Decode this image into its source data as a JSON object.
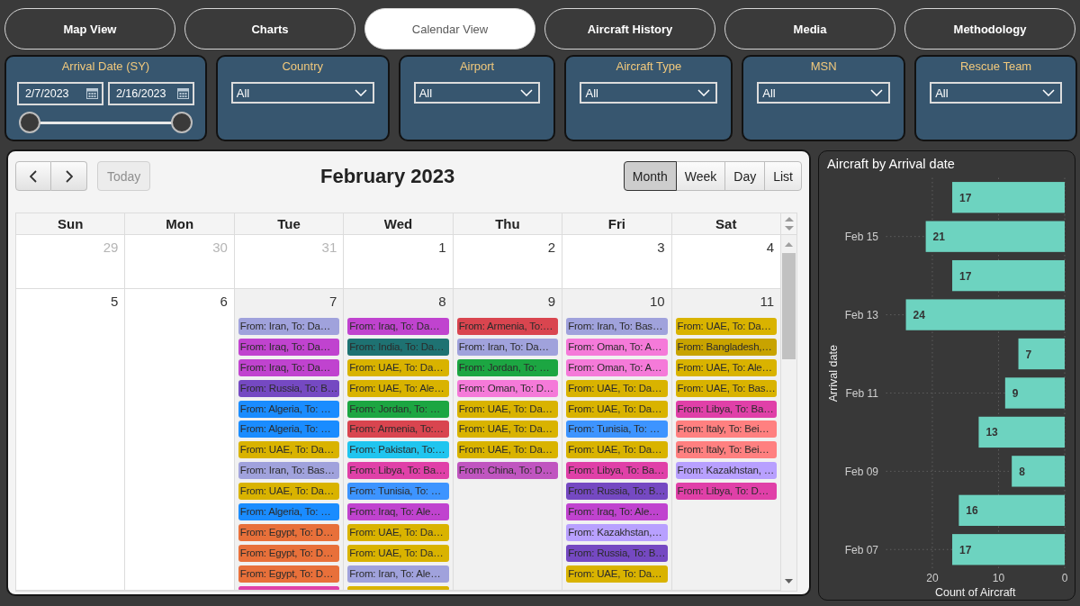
{
  "nav_tabs": [
    {
      "label": "Map View",
      "selected": false
    },
    {
      "label": "Charts",
      "selected": false
    },
    {
      "label": "Calendar View",
      "selected": true
    },
    {
      "label": "Aircraft History",
      "selected": false
    },
    {
      "label": "Media",
      "selected": false
    },
    {
      "label": "Methodology",
      "selected": false
    }
  ],
  "filters": [
    {
      "kind": "date_range",
      "title": "Arrival Date (SY)",
      "start_date": "2/7/2023",
      "end_date": "2/16/2023",
      "thumbs": [
        {
          "level": 0
        },
        {
          "level": 1
        }
      ]
    },
    {
      "kind": "dropdown",
      "title": "Country",
      "value": "All"
    },
    {
      "kind": "dropdown",
      "title": "Airport",
      "value": "All"
    },
    {
      "kind": "dropdown",
      "title": "Aircraft Type",
      "value": "All"
    },
    {
      "kind": "dropdown",
      "title": "MSN",
      "value": "All"
    },
    {
      "kind": "dropdown",
      "title": "Rescue Team",
      "value": "All"
    }
  ],
  "calendar": {
    "today_button": {
      "label": "Today",
      "disabled": true
    },
    "title": "February 2023",
    "views": [
      {
        "label": "Month",
        "selected": true
      },
      {
        "label": "Week",
        "selected": false
      },
      {
        "label": "Day",
        "selected": false
      },
      {
        "label": "List",
        "selected": false
      }
    ],
    "weekdays": [
      "Sun",
      "Mon",
      "Tue",
      "Wed",
      "Thu",
      "Fri",
      "Sat"
    ],
    "weeks": [
      {
        "days": [
          {
            "number": "29",
            "other_month": true,
            "shaded": false
          },
          {
            "number": "30",
            "other_month": true,
            "shaded": false
          },
          {
            "number": "31",
            "other_month": true,
            "shaded": false
          },
          {
            "number": "1",
            "other_month": false,
            "shaded": false
          },
          {
            "number": "2",
            "other_month": false,
            "shaded": false
          },
          {
            "number": "3",
            "other_month": false,
            "shaded": false
          },
          {
            "number": "4",
            "other_month": false,
            "shaded": false
          }
        ]
      },
      {
        "days": [
          {
            "number": "5",
            "other_month": false,
            "shaded": false
          },
          {
            "number": "6",
            "other_month": false,
            "shaded": false
          },
          {
            "number": "7",
            "other_month": false,
            "shaded": true,
            "events": [
              {
                "label": "From: Iran, To: Da…",
                "color": "#a0a2dc"
              },
              {
                "label": "From: Iraq, To: Da…",
                "color": "#c043cf"
              },
              {
                "label": "From: Iraq, To: Da…",
                "color": "#c043cf"
              },
              {
                "label": "From: Russia, To: B…",
                "color": "#7549c2"
              },
              {
                "label": "From: Algeria, To: …",
                "color": "#1a8cff"
              },
              {
                "label": "From: Algeria, To: …",
                "color": "#1a8cff"
              },
              {
                "label": "From: UAE, To: Da…",
                "color": "#d9b300"
              },
              {
                "label": "From: Iran, To: Bas…",
                "color": "#a0a2dc"
              },
              {
                "label": "From: UAE, To: Da…",
                "color": "#d9b300"
              },
              {
                "label": "From: Algeria, To: …",
                "color": "#1a8cff"
              },
              {
                "label": "From: Egypt, To: D…",
                "color": "#e8703a"
              },
              {
                "label": "From: Egypt, To: D…",
                "color": "#e8703a"
              },
              {
                "label": "From: Egypt, To: D…",
                "color": "#e8703a"
              },
              {
                "color": "#e040a8"
              }
            ]
          },
          {
            "number": "8",
            "other_month": false,
            "shaded": true,
            "events": [
              {
                "label": "From: Iraq, To: Da…",
                "color": "#c043cf"
              },
              {
                "label": "From: India, To: Da…",
                "color": "#1e7272"
              },
              {
                "label": "From: UAE, To: Da…",
                "color": "#d9b300"
              },
              {
                "label": "From: UAE, To: Ale…",
                "color": "#d9b300"
              },
              {
                "label": "From: Jordan, To: …",
                "color": "#1ca642"
              },
              {
                "label": "From: Armenia, To:…",
                "color": "#d9454f"
              },
              {
                "label": "From: Pakistan, To:…",
                "color": "#20c5ef"
              },
              {
                "label": "From: Libya, To: Ba…",
                "color": "#e040a8"
              },
              {
                "label": "From: Tunisia, To: …",
                "color": "#3d94ff"
              },
              {
                "label": "From: Iraq, To: Ale…",
                "color": "#c043cf"
              },
              {
                "label": "From: UAE, To: Da…",
                "color": "#d9b300"
              },
              {
                "label": "From: UAE, To: Da…",
                "color": "#d9b300"
              },
              {
                "label": "From: Iran, To: Ale…",
                "color": "#a0a2dc"
              },
              {
                "color": "#d9b300"
              }
            ]
          },
          {
            "number": "9",
            "other_month": false,
            "shaded": true,
            "events": [
              {
                "label": "From: Armenia, To:…",
                "color": "#d9454f"
              },
              {
                "label": "From: Iran, To: Da…",
                "color": "#a0a2dc"
              },
              {
                "label": "From: Jordan, To: …",
                "color": "#1ca642"
              },
              {
                "label": "From: Oman, To: D…",
                "color": "#f57ad9"
              },
              {
                "label": "From: UAE, To: Da…",
                "color": "#d9b300"
              },
              {
                "label": "From: UAE, To: Da…",
                "color": "#d9b300"
              },
              {
                "label": "From: UAE, To: Da…",
                "color": "#d9b300"
              },
              {
                "label": "From: China, To: D…",
                "color": "#c055c0"
              }
            ]
          },
          {
            "number": "10",
            "other_month": false,
            "shaded": true,
            "events": [
              {
                "label": "From: Iran, To: Bas…",
                "color": "#a0a2dc"
              },
              {
                "label": "From: Oman, To: A…",
                "color": "#f57ad9"
              },
              {
                "label": "From: Oman, To: A…",
                "color": "#f57ad9"
              },
              {
                "label": "From: UAE, To: Da…",
                "color": "#d9b300"
              },
              {
                "label": "From: UAE, To: Da…",
                "color": "#d9b300"
              },
              {
                "label": "From: Tunisia, To: …",
                "color": "#3d94ff"
              },
              {
                "label": "From: UAE, To: Da…",
                "color": "#d9b300"
              },
              {
                "label": "From: Libya, To: Ba…",
                "color": "#e040a8"
              },
              {
                "label": "From: Russia, To: B…",
                "color": "#7549c2"
              },
              {
                "label": "From: Iraq, To: Ale…",
                "color": "#c043cf"
              },
              {
                "label": "From: Kazakhstan,…",
                "color": "#b8a0ff"
              },
              {
                "label": "From: Russia, To: B…",
                "color": "#7549c2"
              },
              {
                "label": "From: UAE, To: Da…",
                "color": "#d9b300"
              }
            ]
          },
          {
            "number": "11",
            "other_month": false,
            "shaded": true,
            "events": [
              {
                "label": "From: UAE, To: Da…",
                "color": "#d9b300"
              },
              {
                "label": "From: Bangladesh,…",
                "color": "#c8a300"
              },
              {
                "label": "From: UAE, To: Ale…",
                "color": "#d9b300"
              },
              {
                "label": "From: UAE, To: Bas…",
                "color": "#d9b300"
              },
              {
                "label": "From: Libya, To: Ba…",
                "color": "#e040a8"
              },
              {
                "label": "From: Italy, To: Bei…",
                "color": "#ff8080"
              },
              {
                "label": "From: Italy, To: Bei…",
                "color": "#ff8080"
              },
              {
                "label": "From: Kazakhstan, …",
                "color": "#b8a0ff"
              },
              {
                "label": "From: Libya, To: D…",
                "color": "#e040a8"
              }
            ]
          }
        ]
      }
    ]
  },
  "chart_panel": {
    "title": "Aircraft by Arrival date",
    "chart_data": {
      "type": "bar",
      "orientation": "horizontal",
      "xlabel": "Count of Aircraft",
      "ylabel": "Arrival date",
      "categories": [
        null,
        "Feb 15",
        null,
        "Feb 13",
        null,
        "Feb 11",
        null,
        "Feb 09",
        null,
        "Feb 07"
      ],
      "values": [
        17,
        21,
        17,
        24,
        7,
        9,
        13,
        8,
        16,
        17
      ],
      "xlim": [
        27,
        0
      ],
      "xticks": [
        20,
        10,
        0
      ],
      "data_labels": true
    }
  }
}
